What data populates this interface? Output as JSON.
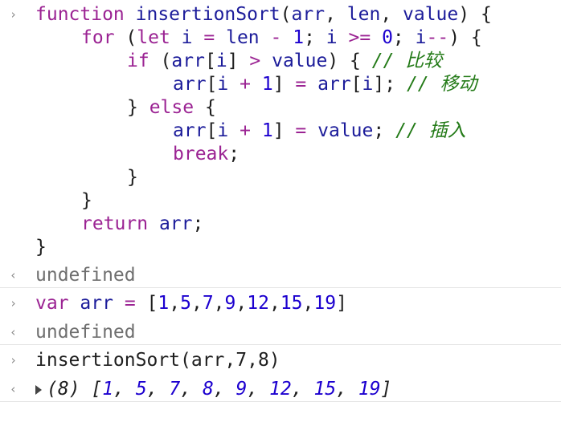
{
  "console": {
    "prompt_glyph": "›",
    "return_glyph": "‹",
    "function_block": {
      "lines": [
        {
          "indent": 0,
          "tokens": [
            [
              "kw",
              "function"
            ],
            [
              "pl",
              " "
            ],
            [
              "id",
              "insertionSort"
            ],
            [
              "pl",
              "("
            ],
            [
              "id",
              "arr"
            ],
            [
              "pl",
              ", "
            ],
            [
              "id",
              "len"
            ],
            [
              "pl",
              ", "
            ],
            [
              "id",
              "value"
            ],
            [
              "pl",
              ") {"
            ]
          ]
        },
        {
          "indent": 1,
          "tokens": [
            [
              "kw",
              "for"
            ],
            [
              "pl",
              " ("
            ],
            [
              "kw",
              "let"
            ],
            [
              "pl",
              " "
            ],
            [
              "id",
              "i"
            ],
            [
              "pl",
              " "
            ],
            [
              "op",
              "="
            ],
            [
              "pl",
              " "
            ],
            [
              "id",
              "len"
            ],
            [
              "pl",
              " "
            ],
            [
              "op",
              "-"
            ],
            [
              "pl",
              " "
            ],
            [
              "num",
              "1"
            ],
            [
              "pl",
              "; "
            ],
            [
              "id",
              "i"
            ],
            [
              "pl",
              " "
            ],
            [
              "op",
              ">="
            ],
            [
              "pl",
              " "
            ],
            [
              "num",
              "0"
            ],
            [
              "pl",
              "; "
            ],
            [
              "id",
              "i"
            ],
            [
              "op",
              "--"
            ],
            [
              "pl",
              ") {"
            ]
          ]
        },
        {
          "indent": 2,
          "tokens": [
            [
              "kw",
              "if"
            ],
            [
              "pl",
              " ("
            ],
            [
              "id",
              "arr"
            ],
            [
              "pl",
              "["
            ],
            [
              "id",
              "i"
            ],
            [
              "pl",
              "] "
            ],
            [
              "op",
              ">"
            ],
            [
              "pl",
              " "
            ],
            [
              "id",
              "value"
            ],
            [
              "pl",
              ") { "
            ],
            [
              "cm",
              "// 比较"
            ]
          ]
        },
        {
          "indent": 3,
          "tokens": [
            [
              "id",
              "arr"
            ],
            [
              "pl",
              "["
            ],
            [
              "id",
              "i"
            ],
            [
              "pl",
              " "
            ],
            [
              "op",
              "+"
            ],
            [
              "pl",
              " "
            ],
            [
              "num",
              "1"
            ],
            [
              "pl",
              "] "
            ],
            [
              "op",
              "="
            ],
            [
              "pl",
              " "
            ],
            [
              "id",
              "arr"
            ],
            [
              "pl",
              "["
            ],
            [
              "id",
              "i"
            ],
            [
              "pl",
              "]; "
            ],
            [
              "cm",
              "// 移动"
            ]
          ]
        },
        {
          "indent": 2,
          "tokens": [
            [
              "pl",
              "} "
            ],
            [
              "kw",
              "else"
            ],
            [
              "pl",
              " {"
            ]
          ]
        },
        {
          "indent": 3,
          "tokens": [
            [
              "id",
              "arr"
            ],
            [
              "pl",
              "["
            ],
            [
              "id",
              "i"
            ],
            [
              "pl",
              " "
            ],
            [
              "op",
              "+"
            ],
            [
              "pl",
              " "
            ],
            [
              "num",
              "1"
            ],
            [
              "pl",
              "] "
            ],
            [
              "op",
              "="
            ],
            [
              "pl",
              " "
            ],
            [
              "id",
              "value"
            ],
            [
              "pl",
              "; "
            ],
            [
              "cm",
              "// 插入"
            ]
          ]
        },
        {
          "indent": 3,
          "tokens": [
            [
              "kw",
              "break"
            ],
            [
              "pl",
              ";"
            ]
          ]
        },
        {
          "indent": 2,
          "tokens": [
            [
              "pl",
              "}"
            ]
          ]
        },
        {
          "indent": 1,
          "tokens": [
            [
              "pl",
              "}"
            ]
          ]
        },
        {
          "indent": 1,
          "tokens": [
            [
              "kw",
              "return"
            ],
            [
              "pl",
              " "
            ],
            [
              "id",
              "arr"
            ],
            [
              "pl",
              ";"
            ]
          ]
        },
        {
          "indent": 0,
          "tokens": [
            [
              "pl",
              "}"
            ]
          ]
        }
      ],
      "result": "undefined"
    },
    "var_entry": {
      "tokens": [
        [
          "kw",
          "var"
        ],
        [
          "pl",
          " "
        ],
        [
          "id",
          "arr"
        ],
        [
          "pl",
          " "
        ],
        [
          "op",
          "="
        ],
        [
          "pl",
          " ["
        ],
        [
          "num",
          "1"
        ],
        [
          "pl",
          ","
        ],
        [
          "num",
          "5"
        ],
        [
          "pl",
          ","
        ],
        [
          "num",
          "7"
        ],
        [
          "pl",
          ","
        ],
        [
          "num",
          "9"
        ],
        [
          "pl",
          ","
        ],
        [
          "num",
          "12"
        ],
        [
          "pl",
          ","
        ],
        [
          "num",
          "15"
        ],
        [
          "pl",
          ","
        ],
        [
          "num",
          "19"
        ],
        [
          "pl",
          "]"
        ]
      ],
      "result": "undefined"
    },
    "call_entry": {
      "tokens": [
        [
          "pl",
          "insertionSort(arr,7,8)"
        ]
      ],
      "result_prefix": "(8)",
      "result_array": [
        "1",
        "5",
        "7",
        "8",
        "9",
        "12",
        "15",
        "19"
      ]
    }
  }
}
